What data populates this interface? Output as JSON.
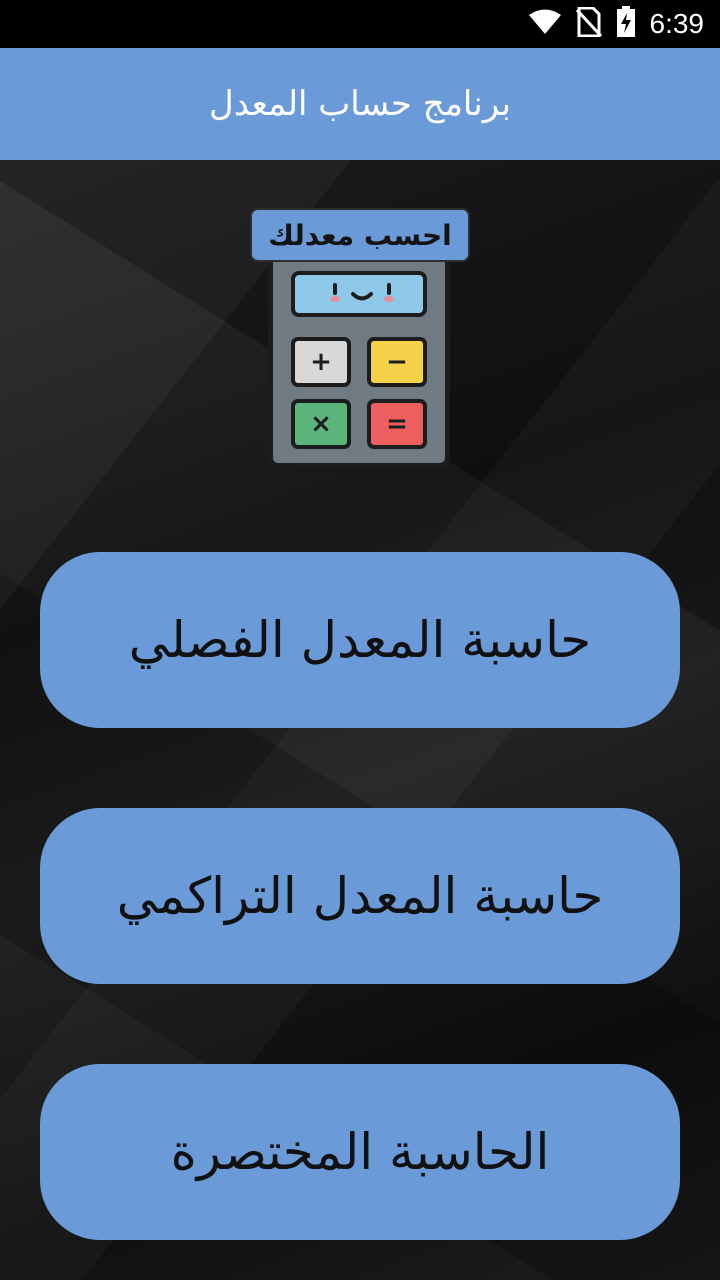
{
  "status_bar": {
    "time": "6:39",
    "icons": [
      "wifi-icon",
      "no-sim-icon",
      "battery-charging-icon"
    ]
  },
  "app_bar": {
    "title": "برنامج حساب المعدل"
  },
  "logo": {
    "label": "احسب معدلك",
    "keys": [
      "+",
      "−",
      "×",
      "="
    ]
  },
  "menu": {
    "semester_gpa": "حاسبة المعدل الفصلي",
    "cumulative_gpa": "حاسبة المعدل التراكمي",
    "quick_calc": "الحاسبة المختصرة"
  },
  "colors": {
    "accent": "#6a9bd8",
    "status_bar": "#000000",
    "background": "#151515"
  }
}
